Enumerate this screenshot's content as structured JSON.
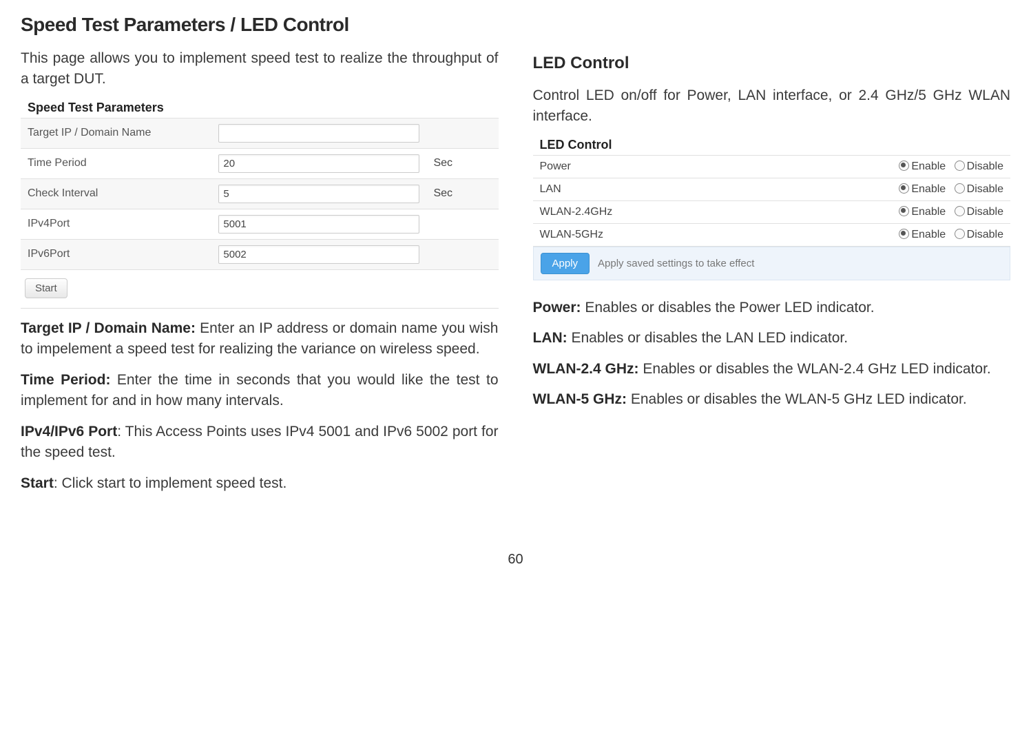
{
  "title": "Speed Test Parameters / LED Control",
  "pageNumber": "60",
  "left": {
    "intro": "This page allows you to implement speed test to realize the throughput of a target DUT.",
    "panelTitle": "Speed Test Parameters",
    "rows": {
      "target": {
        "label": "Target IP / Domain Name",
        "value": "",
        "unit": ""
      },
      "time": {
        "label": "Time Period",
        "value": "20",
        "unit": "Sec"
      },
      "check": {
        "label": "Check Interval",
        "value": "5",
        "unit": "Sec"
      },
      "ipv4": {
        "label": "IPv4Port",
        "value": "5001",
        "unit": ""
      },
      "ipv6": {
        "label": "IPv6Port",
        "value": "5002",
        "unit": ""
      }
    },
    "startLabel": "Start",
    "descriptions": {
      "target": {
        "bold": "Target IP / Domain Name: ",
        "text": "Enter an IP address or domain name you wish to impelement a speed test for realizing the variance on wireless speed."
      },
      "time": {
        "bold": "Time Period: ",
        "text": "Enter the time in seconds that you would like the test to implement for and in how many intervals."
      },
      "port": {
        "bold": "IPv4/IPv6 Port",
        "text": ": This Access Points uses IPv4 5001 and IPv6 5002 port for the speed test."
      },
      "start": {
        "bold": "Start",
        "text": ": Click start to implement speed test."
      }
    }
  },
  "right": {
    "heading": "LED Control",
    "intro": "Control LED on/off for Power, LAN interface, or 2.4 GHz/5 GHz WLAN interface.",
    "panelTitle": "LED Control",
    "options": {
      "enable": "Enable",
      "disable": "Disable"
    },
    "rows": {
      "power": {
        "label": "Power",
        "selected": "enable"
      },
      "lan": {
        "label": "LAN",
        "selected": "enable"
      },
      "wlan24": {
        "label": "WLAN-2.4GHz",
        "selected": "enable"
      },
      "wlan5": {
        "label": "WLAN-5GHz",
        "selected": "enable"
      }
    },
    "applyLabel": "Apply",
    "applyNote": "Apply saved settings to take effect",
    "descriptions": {
      "power": {
        "bold": "Power: ",
        "text": "Enables or disables the Power LED indicator."
      },
      "lan": {
        "bold": "LAN: ",
        "text": "Enables or disables the LAN LED indicator."
      },
      "wlan24": {
        "bold": "WLAN-2.4 GHz: ",
        "text": "Enables or disables the WLAN-2.4 GHz LED indicator."
      },
      "wlan5": {
        "bold": "WLAN-5 GHz: ",
        "text": "Enables or disables the WLAN-5 GHz LED indicator."
      }
    }
  }
}
